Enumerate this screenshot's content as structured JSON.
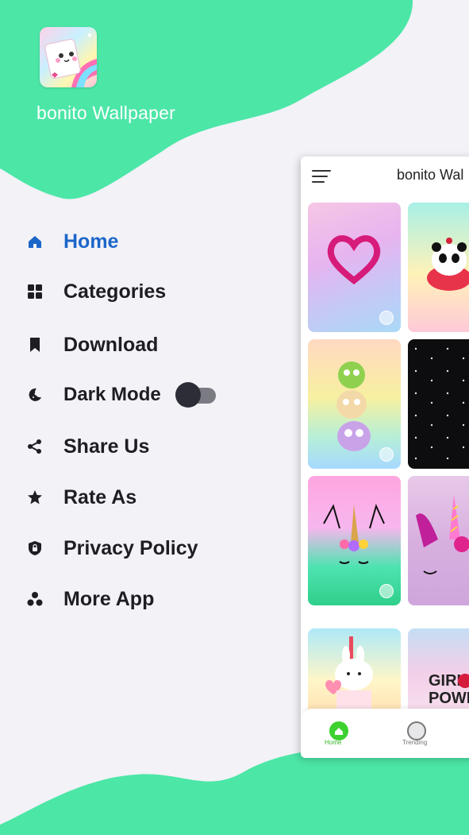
{
  "app": {
    "name": "bonito Wallpaper"
  },
  "menu": {
    "items": [
      {
        "label": "Home",
        "icon": "home-icon",
        "active": true
      },
      {
        "label": "Categories",
        "icon": "grid-icon"
      },
      {
        "label": "Download",
        "icon": "bookmark-icon"
      },
      {
        "label": "Dark Mode",
        "icon": "moon-icon",
        "toggle": false
      },
      {
        "label": "Share Us",
        "icon": "share-icon"
      },
      {
        "label": "Rate As",
        "icon": "star-icon"
      },
      {
        "label": "Privacy Policy",
        "icon": "shield-lock-icon"
      },
      {
        "label": "More App",
        "icon": "apps-icon"
      }
    ]
  },
  "preview": {
    "title": "bonito Wal",
    "bottom_nav": {
      "home": "Home",
      "trending": "Trending"
    }
  },
  "colors": {
    "accent_green": "#4ce6a7",
    "active_blue": "#1b66c9",
    "background": "#f2f2f7",
    "text_dark": "#1e1e22"
  }
}
